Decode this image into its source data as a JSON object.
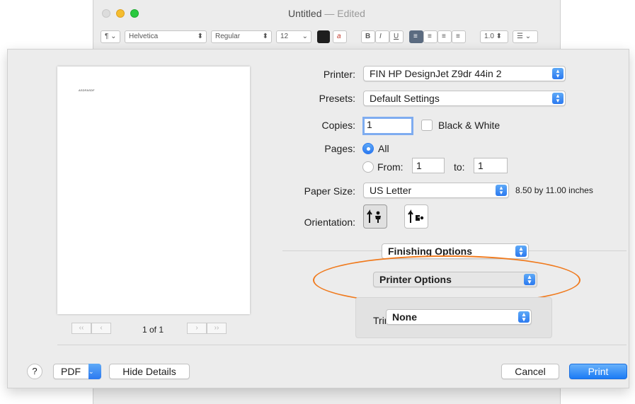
{
  "window": {
    "title": "Untitled",
    "title_suffix": "— Edited",
    "toolbar": {
      "paragraph": "¶",
      "font_family": "Helvetica",
      "font_style": "Regular",
      "font_size": "12",
      "line_spacing": "1.0"
    }
  },
  "preview": {
    "page_text": "ASDFASDF",
    "page_count": "1 of 1"
  },
  "printer": {
    "label": "Printer:",
    "value": "FIN HP DesignJet Z9dr 44in 2"
  },
  "presets": {
    "label": "Presets:",
    "value": "Default Settings"
  },
  "copies": {
    "label": "Copies:",
    "value": "1",
    "bw_label": "Black & White"
  },
  "pages": {
    "label": "Pages:",
    "all_label": "All",
    "from_label": "From:",
    "from_value": "1",
    "to_label": "to:",
    "to_value": "1"
  },
  "paper_size": {
    "label": "Paper Size:",
    "value": "US Letter",
    "dimensions": "8.50 by 11.00 inches"
  },
  "orientation": {
    "label": "Orientation:"
  },
  "section_popup": {
    "value": "Finishing Options"
  },
  "options_popup": {
    "value": "Printer Options"
  },
  "trim": {
    "label": "Trim:",
    "value": "None"
  },
  "footer": {
    "help": "?",
    "pdf": "PDF",
    "hide_details": "Hide Details",
    "cancel": "Cancel",
    "print": "Print"
  },
  "colors": {
    "accent": "#2b79f0",
    "highlight": "#f07a1d"
  }
}
